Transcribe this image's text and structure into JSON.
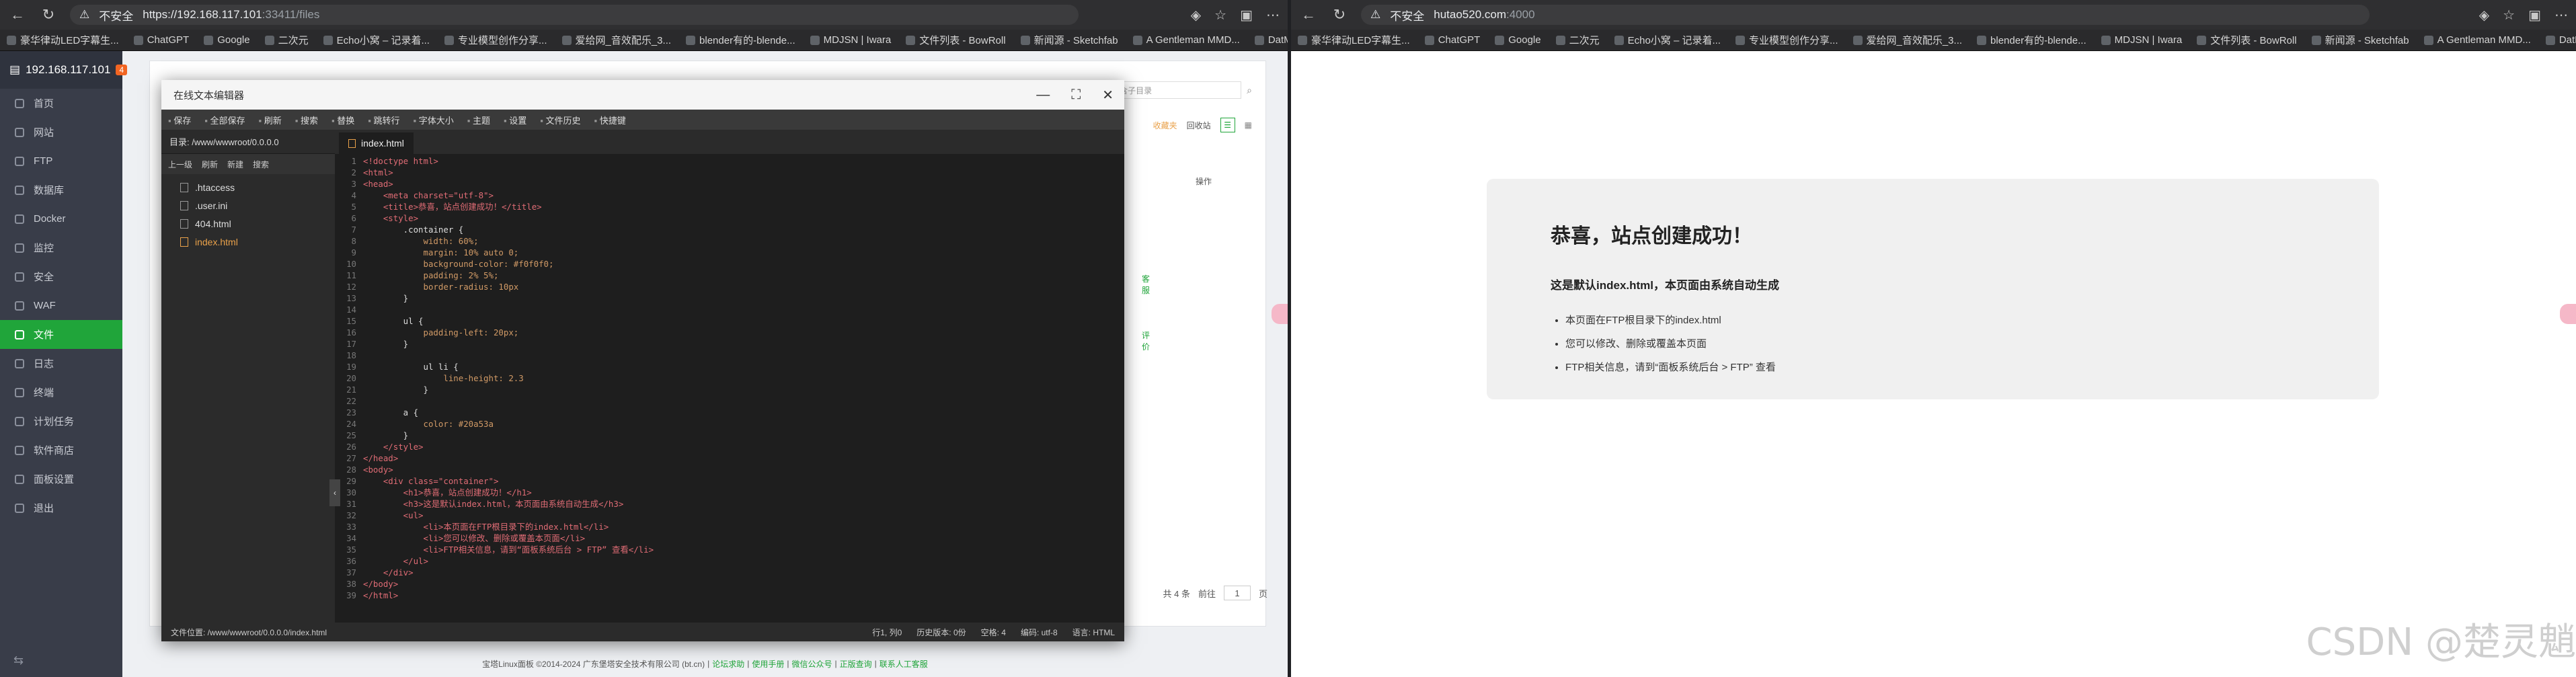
{
  "left_browser": {
    "security": "不安全",
    "url_scheme": "https://",
    "url_host": "192.168.117.101",
    "url_rest": ":33411/files",
    "bookmarks": [
      "豪华律动LED字幕生...",
      "ChatGPT",
      "Google",
      "二次元",
      "Echo小窝 – 记录着...",
      "专业模型创作分享...",
      "爱给网_音效配乐_3...",
      "blender有的-blende...",
      "MDJSN | Iwara",
      "文件列表 - BowRoll",
      "新闻源 - Sketchfab",
      "A Gentleman MMD...",
      "DatMMDGuy | Iwara"
    ]
  },
  "panel": {
    "ip": "192.168.117.101",
    "badge": "4",
    "nav": [
      "首页",
      "网站",
      "FTP",
      "数据库",
      "Docker",
      "监控",
      "安全",
      "WAF",
      "文件",
      "日志",
      "终端",
      "计划任务",
      "软件商店",
      "面板设置",
      "退出"
    ],
    "active_index": 8,
    "behind_search_placeholder": "包含子目录",
    "behind_favorites": "收藏夹",
    "behind_recycle": "回收站",
    "behind_op_col": "操作",
    "pager_total": "共 4 条",
    "pager_goto": "前往",
    "pager_page": "1",
    "pager_unit": "页",
    "right_tools": [
      "客服",
      "评价"
    ],
    "footer_text": "宝塔Linux面板 ©2014-2024 广东堡塔安全技术有限公司 (bt.cn)",
    "footer_links": [
      "论坛求助",
      "使用手册",
      "微信公众号",
      "正版查询",
      "联系人工客服"
    ]
  },
  "editor": {
    "title": "在线文本编辑器",
    "toolbar": [
      "保存",
      "全部保存",
      "刷新",
      "搜索",
      "替换",
      "跳转行",
      "字体大小",
      "主题",
      "设置",
      "文件历史",
      "快捷键"
    ],
    "dir_label": "目录: /www/wwwroot/0.0.0.0",
    "dir_actions": [
      "上一级",
      "刷新",
      "新建",
      "搜索"
    ],
    "files": [
      ".htaccess",
      ".user.ini",
      "404.html",
      "index.html"
    ],
    "active_file": "index.html",
    "tab": "index.html",
    "status_path": "文件位置: /www/wwwroot/0.0.0.0/index.html",
    "status_pos": "行1, 列0",
    "status_hist": "历史版本: 0份",
    "status_indent": "空格: 4",
    "status_enc": "编码: utf-8",
    "status_lang": "语言: HTML",
    "code_lines": [
      "<!doctype html>",
      "<html>",
      "<head>",
      "    <meta charset=\"utf-8\">",
      "    <title>恭喜，站点创建成功！</title>",
      "    <style>",
      "        .container {",
      "            width: 60%;",
      "            margin: 10% auto 0;",
      "            background-color: #f0f0f0;",
      "            padding: 2% 5%;",
      "            border-radius: 10px",
      "        }",
      "",
      "        ul {",
      "            padding-left: 20px;",
      "        }",
      "",
      "            ul li {",
      "                line-height: 2.3",
      "            }",
      "",
      "        a {",
      "            color: #20a53a",
      "        }",
      "    </style>",
      "</head>",
      "<body>",
      "    <div class=\"container\">",
      "        <h1>恭喜，站点创建成功！</h1>",
      "        <h3>这是默认index.html，本页面由系统自动生成</h3>",
      "        <ul>",
      "            <li>本页面在FTP根目录下的index.html</li>",
      "            <li>您可以修改、删除或覆盖本页面</li>",
      "            <li>FTP相关信息，请到“面板系统后台 > FTP” 查看</li>",
      "        </ul>",
      "    </div>",
      "</body>",
      "</html>"
    ]
  },
  "right_browser": {
    "security": "不安全",
    "url": "hutao520.com",
    "url_port": ":4000",
    "bookmarks": [
      "豪华律动LED字幕生...",
      "ChatGPT",
      "Google",
      "二次元",
      "Echo小窝 – 记录着...",
      "专业模型创作分享...",
      "爱给网_音效配乐_3...",
      "blender有的-blende...",
      "MDJSN | Iwara",
      "文件列表 - BowRoll",
      "新闻源 - Sketchfab",
      "A Gentleman MMD...",
      "DatMMDGuy | Iwara"
    ]
  },
  "welcome": {
    "h1": "恭喜，站点创建成功！",
    "h3": "这是默认index.html，本页面由系统自动生成",
    "items": [
      "本页面在FTP根目录下的index.html",
      "您可以修改、删除或覆盖本页面",
      "FTP相关信息，请到“面板系统后台 > FTP” 查看"
    ]
  },
  "watermark": "CSDN @楚灵魈",
  "colors": {
    "accent": "#20a53a",
    "sidebar": "#393d49",
    "editor_bg": "#1e1e1e"
  }
}
